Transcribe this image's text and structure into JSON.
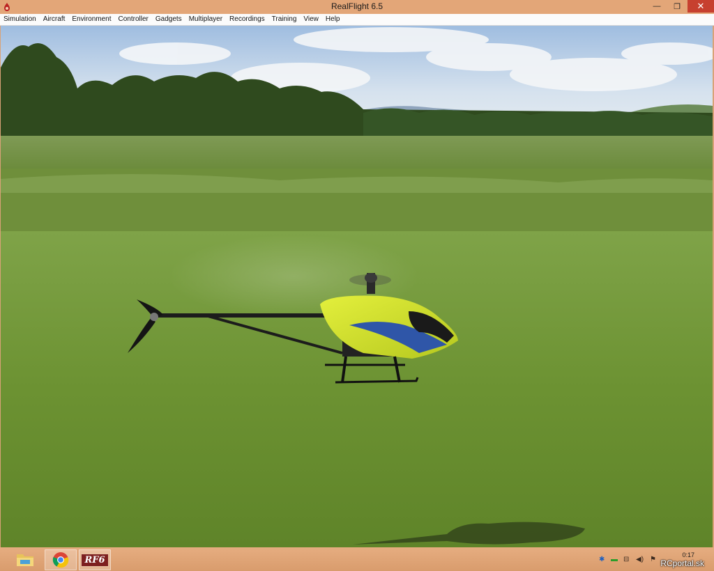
{
  "window": {
    "title": "RealFlight 6.5",
    "controls": {
      "minimize": "—",
      "restore": "❐",
      "close": "✕"
    }
  },
  "menu": {
    "items": [
      "Simulation",
      "Aircraft",
      "Environment",
      "Controller",
      "Gadgets",
      "Multiplayer",
      "Recordings",
      "Training",
      "View",
      "Help"
    ]
  },
  "taskbar": {
    "apps": [
      {
        "name": "file-explorer",
        "icon": "folder-icon"
      },
      {
        "name": "chrome",
        "icon": "chrome-icon"
      },
      {
        "name": "realflight",
        "label": "RF6"
      }
    ],
    "tray": {
      "time": "0:17",
      "watermark": "RCportal.sk",
      "icons": [
        "bluetooth-icon",
        "battery-icon",
        "network-icon",
        "speaker-icon",
        "flag-icon"
      ]
    }
  },
  "colors": {
    "titlebar": "#e3a678",
    "close": "#c7402f",
    "grass": "#6a8c2e",
    "sky": "#b7cde6",
    "canopy": "#d3e23a",
    "canopy_accent": "#2f56a8"
  }
}
